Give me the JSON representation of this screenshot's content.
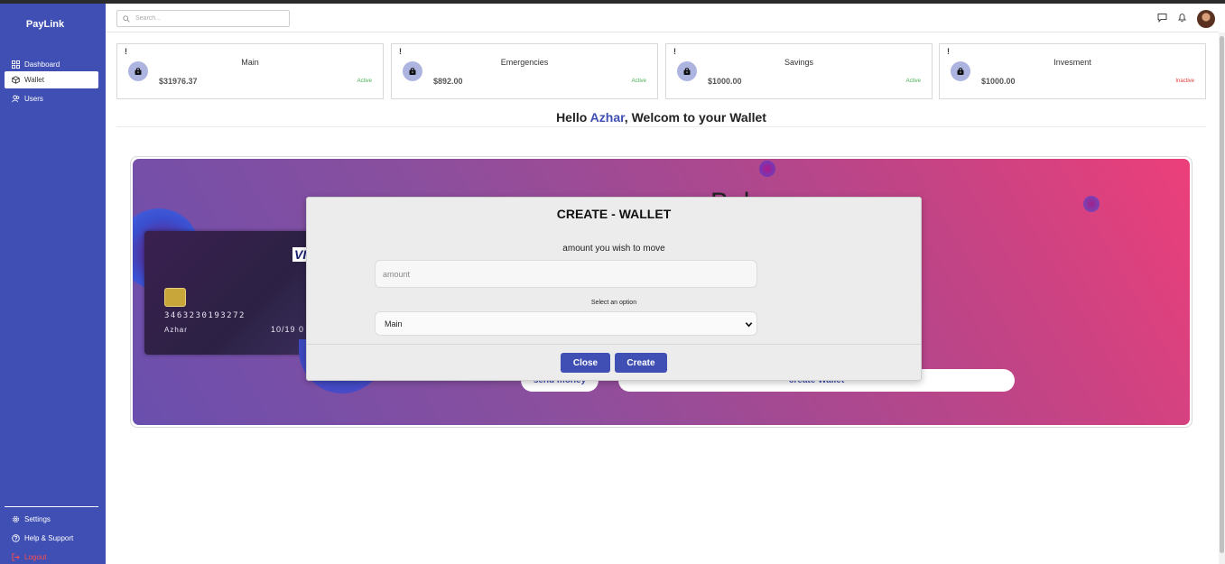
{
  "app": {
    "brand": "PayLink"
  },
  "sidebar": {
    "items": [
      {
        "label": "Dashboard",
        "icon": "dashboard-icon"
      },
      {
        "label": "Wallet",
        "icon": "wallet-icon",
        "active": true
      },
      {
        "label": "Users",
        "icon": "users-icon"
      }
    ],
    "bottom_items": [
      {
        "label": "Settings",
        "icon": "gear-icon"
      },
      {
        "label": "Help & Support",
        "icon": "help-icon"
      },
      {
        "label": "Logout",
        "icon": "logout-icon"
      }
    ]
  },
  "header": {
    "search_placeholder": "Search...",
    "icons": [
      "message-icon",
      "bell-icon",
      "avatar"
    ]
  },
  "wallets": [
    {
      "badge": "!",
      "name": "Main",
      "amount": "$31976.37",
      "status": "Active"
    },
    {
      "badge": "!",
      "name": "Emergencies",
      "amount": "$892.00",
      "status": "Active"
    },
    {
      "badge": "!",
      "name": "Savings",
      "amount": "$1000.00",
      "status": "Active"
    },
    {
      "badge": "!",
      "name": "Invesment",
      "amount": "$1000.00",
      "status": "Inactive"
    }
  ],
  "greeting": {
    "prefix": "Hello ",
    "name": "Azhar",
    "suffix": ", Welcom to your Wallet"
  },
  "banner": {
    "balance_ghost": "Bal",
    "card": {
      "brand": "VISA",
      "number": "3463230193272",
      "holder": "Azhar",
      "expiry": "10/19 0"
    },
    "send_money_label": "send money",
    "create_wallet_label": "create Wallet"
  },
  "modal": {
    "title": "CREATE - WALLET",
    "amount_label": "amount you wish to move",
    "amount_placeholder": "amount",
    "select_label": "Select an option",
    "select_value": "Main",
    "close_label": "Close",
    "create_label": "Create"
  },
  "colors": {
    "sidebar": "#3f4fb4",
    "accent": "#3f4fb4",
    "active_status": "#4caf50",
    "inactive_status": "#e53935",
    "logout": "#ff4d4d"
  }
}
